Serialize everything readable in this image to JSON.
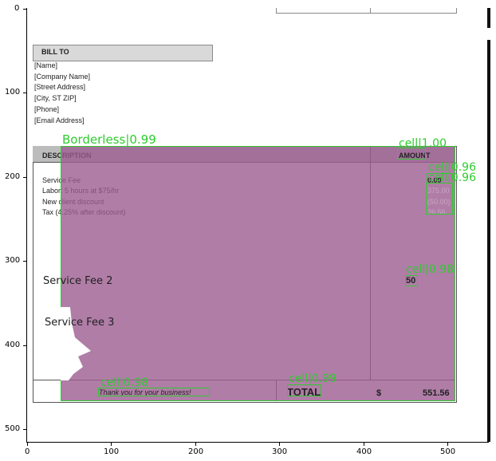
{
  "axes": {
    "y_ticks": [
      "0",
      "100",
      "200",
      "300",
      "400",
      "500"
    ],
    "x_ticks": [
      "0",
      "100",
      "200",
      "300",
      "400",
      "500"
    ]
  },
  "bill_to": {
    "title": "BILL TO",
    "lines": [
      "[Name]",
      "[Company Name]",
      "[Street Address]",
      "[City, ST  ZIP]",
      "[Phone]",
      "[Email Address]"
    ]
  },
  "table": {
    "description_header": "DESCRIPTION",
    "amount_header": "AMOUNT",
    "items": [
      "Service Fee",
      "Labor: 5 hours at $75/hr",
      "New client discount",
      "Tax (4.25% after discount)"
    ],
    "amounts": [
      "0.00",
      "375.00",
      "(50.00)",
      "26.56"
    ],
    "extra_items": [
      "Service Fee 2",
      "Service Fee 3"
    ],
    "extra_amount": "50",
    "thanks": "Thank you for your business!",
    "total_label": "TOTAL",
    "currency": "$",
    "total_value": "551.56"
  },
  "detections": {
    "borderless": "Borderless|0.99",
    "cell_amount": "cell|1.00",
    "cell_a": "cell|0.96",
    "cell_b": "cell|0.96",
    "cell_50": "cell|0.98",
    "cell_thanks": "cell|0.98",
    "cell_total": "cell|0.99"
  },
  "colors": {
    "overlay": "#9c5c91",
    "detection": "#2ecc2e"
  }
}
